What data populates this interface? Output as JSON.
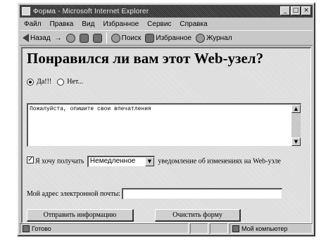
{
  "window": {
    "title": "Форма - Microsoft Internet Explorer",
    "controls": [
      "_",
      "□",
      "×"
    ]
  },
  "menu": [
    "Файл",
    "Правка",
    "Вид",
    "Избранное",
    "Сервис",
    "Справка"
  ],
  "toolbar": {
    "back": "Назад",
    "forward": "→",
    "stop_icon": "stop-icon",
    "refresh_icon": "refresh-icon",
    "home_icon": "home-icon",
    "search": "Поиск",
    "favorites": "Избранное",
    "journal": "Журнал"
  },
  "page": {
    "heading": "Понравился ли вам этот Web-узел?",
    "radio_yes": "Да!!!",
    "radio_no": "Нет...",
    "comment_text": "Пожалуйста, опишите свои впечатления",
    "notify_prefix": "Я хочу получать",
    "notify_selected": "Немедленное",
    "notify_suffix": "уведомление об изменениях на Web-узле",
    "email_label": "Мой адрес электронной почты:",
    "email_value": "",
    "submit_label": "Отправить информацию",
    "reset_label": "Очистить форму"
  },
  "status": {
    "left": "Готово",
    "zone": "Мой компьютер"
  }
}
